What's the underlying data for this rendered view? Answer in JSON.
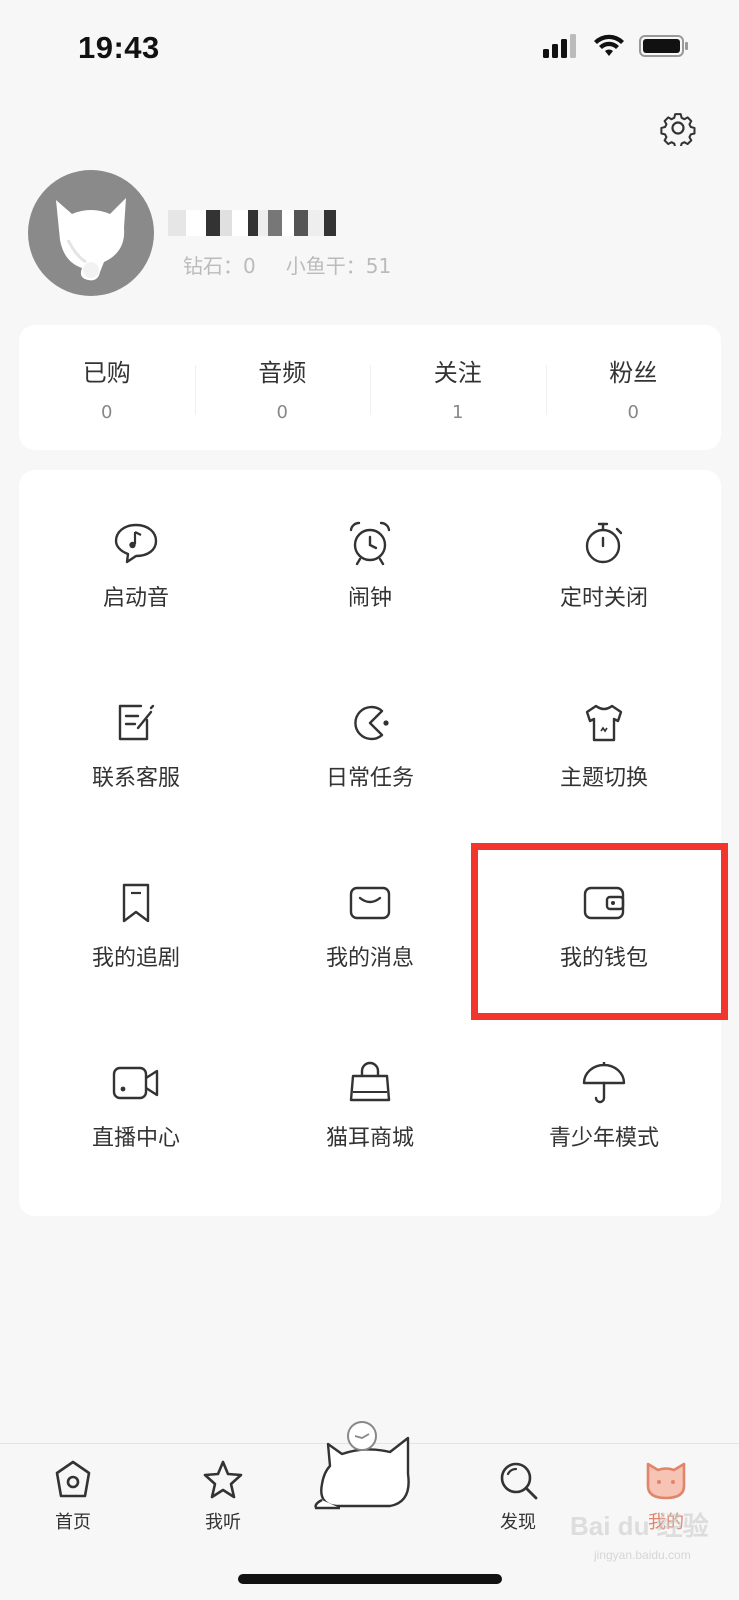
{
  "status": {
    "time": "19:43"
  },
  "profile": {
    "diamonds_label": "钻石：0",
    "fish_label": "小鱼干：51"
  },
  "counts": [
    {
      "label": "已购",
      "value": "0"
    },
    {
      "label": "音频",
      "value": "0"
    },
    {
      "label": "关注",
      "value": "1"
    },
    {
      "label": "粉丝",
      "value": "0"
    }
  ],
  "menu": [
    {
      "label": "启动音",
      "icon": "speech-bubble-music-icon"
    },
    {
      "label": "闹钟",
      "icon": "alarm-clock-icon"
    },
    {
      "label": "定时关闭",
      "icon": "stopwatch-icon"
    },
    {
      "label": "联系客服",
      "icon": "edit-note-icon"
    },
    {
      "label": "日常任务",
      "icon": "pacman-icon"
    },
    {
      "label": "主题切换",
      "icon": "tshirt-icon"
    },
    {
      "label": "我的追剧",
      "icon": "bookmark-icon"
    },
    {
      "label": "我的消息",
      "icon": "message-box-icon"
    },
    {
      "label": "我的钱包",
      "icon": "wallet-icon"
    },
    {
      "label": "直播中心",
      "icon": "video-camera-icon"
    },
    {
      "label": "猫耳商城",
      "icon": "shopping-bag-icon"
    },
    {
      "label": "青少年模式",
      "icon": "umbrella-icon"
    }
  ],
  "tabs": [
    {
      "label": "首页",
      "icon": "home-icon"
    },
    {
      "label": "我听",
      "icon": "star-icon"
    },
    {
      "label": "发现",
      "icon": "search-icon"
    },
    {
      "label": "我的",
      "icon": "cat-face-icon"
    }
  ],
  "watermark": {
    "text": "Bai du 经验",
    "sub": "jingyan.baidu.com"
  },
  "colors": {
    "highlight": "#f2352d",
    "active_tab": "#e0856a"
  }
}
